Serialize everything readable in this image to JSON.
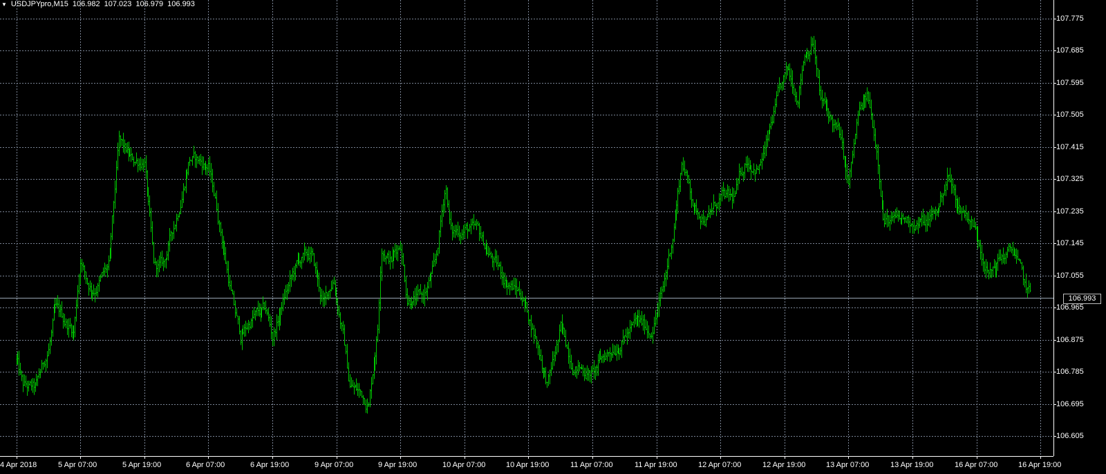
{
  "header": {
    "menu_icon": "triangle-down-icon",
    "symbol": "USDJPYpro,M15",
    "open": "106.982",
    "high": "107.023",
    "low": "106.979",
    "close": "106.993"
  },
  "colors": {
    "background": "#000000",
    "grid": "#7b8596",
    "bars": "#00c800",
    "axis": "#ffffff",
    "bid_line": "#9aa7b4"
  },
  "current_price": "106.993",
  "chart_data": {
    "type": "ohlc-bar",
    "title": "USDJPYpro,M15",
    "y_ticks": [
      "107.775",
      "107.685",
      "107.595",
      "107.505",
      "107.415",
      "107.325",
      "107.235",
      "107.145",
      "107.055",
      "106.965",
      "106.875",
      "106.785",
      "106.695",
      "106.605"
    ],
    "ylim": [
      106.59,
      107.79
    ],
    "x_ticks": [
      "4 Apr 2018",
      "5 Apr 07:00",
      "5 Apr 19:00",
      "6 Apr 07:00",
      "6 Apr 19:00",
      "9 Apr 07:00",
      "9 Apr 19:00",
      "10 Apr 07:00",
      "10 Apr 19:00",
      "11 Apr 07:00",
      "11 Apr 19:00",
      "12 Apr 07:00",
      "12 Apr 19:00",
      "13 Apr 07:00",
      "13 Apr 19:00",
      "16 Apr 07:00",
      "16 Apr 19:00"
    ],
    "grid": true,
    "series": [
      {
        "price_path": [
          {
            "t": 0,
            "p": 106.82
          },
          {
            "t": 0.1,
            "p": 106.74
          },
          {
            "t": 0.3,
            "p": 106.73
          },
          {
            "t": 0.5,
            "p": 106.85
          },
          {
            "t": 0.6,
            "p": 106.95
          },
          {
            "t": 0.9,
            "p": 106.9
          },
          {
            "t": 1.0,
            "p": 107.11
          },
          {
            "t": 1.1,
            "p": 107.04
          },
          {
            "t": 1.2,
            "p": 107.02
          },
          {
            "t": 1.45,
            "p": 107.08
          },
          {
            "t": 1.6,
            "p": 107.42
          },
          {
            "t": 1.8,
            "p": 107.37
          },
          {
            "t": 2.0,
            "p": 107.38
          },
          {
            "t": 2.15,
            "p": 107.07
          },
          {
            "t": 2.3,
            "p": 107.08
          },
          {
            "t": 2.5,
            "p": 107.22
          },
          {
            "t": 2.7,
            "p": 107.39
          },
          {
            "t": 3.0,
            "p": 107.36
          },
          {
            "t": 3.1,
            "p": 107.27
          },
          {
            "t": 3.25,
            "p": 107.12
          },
          {
            "t": 3.4,
            "p": 106.96
          },
          {
            "t": 3.5,
            "p": 106.88
          },
          {
            "t": 3.7,
            "p": 106.94
          },
          {
            "t": 3.9,
            "p": 106.95
          },
          {
            "t": 4.0,
            "p": 106.88
          },
          {
            "t": 4.2,
            "p": 107.0
          },
          {
            "t": 4.4,
            "p": 107.09
          },
          {
            "t": 4.6,
            "p": 107.11
          },
          {
            "t": 4.8,
            "p": 106.97
          },
          {
            "t": 4.95,
            "p": 107.05
          },
          {
            "t": 5.1,
            "p": 106.9
          },
          {
            "t": 5.2,
            "p": 106.75
          },
          {
            "t": 5.4,
            "p": 106.72
          },
          {
            "t": 5.5,
            "p": 106.7
          },
          {
            "t": 5.65,
            "p": 106.92
          },
          {
            "t": 5.7,
            "p": 107.15
          },
          {
            "t": 5.85,
            "p": 107.1
          },
          {
            "t": 6.0,
            "p": 107.15
          },
          {
            "t": 6.1,
            "p": 107.0
          },
          {
            "t": 6.35,
            "p": 106.99
          },
          {
            "t": 6.55,
            "p": 107.08
          },
          {
            "t": 6.7,
            "p": 107.31
          },
          {
            "t": 6.8,
            "p": 107.17
          },
          {
            "t": 7.0,
            "p": 107.19
          },
          {
            "t": 7.2,
            "p": 107.17
          },
          {
            "t": 7.4,
            "p": 107.11
          },
          {
            "t": 7.6,
            "p": 107.05
          },
          {
            "t": 7.9,
            "p": 107.0
          },
          {
            "t": 8.1,
            "p": 106.89
          },
          {
            "t": 8.3,
            "p": 106.75
          },
          {
            "t": 8.5,
            "p": 106.9
          },
          {
            "t": 8.7,
            "p": 106.81
          },
          {
            "t": 9.0,
            "p": 106.78
          },
          {
            "t": 9.2,
            "p": 106.83
          },
          {
            "t": 9.5,
            "p": 106.89
          },
          {
            "t": 9.7,
            "p": 106.92
          },
          {
            "t": 9.9,
            "p": 106.9
          },
          {
            "t": 10.1,
            "p": 107.01
          },
          {
            "t": 10.25,
            "p": 107.17
          },
          {
            "t": 10.4,
            "p": 107.38
          },
          {
            "t": 10.6,
            "p": 107.24
          },
          {
            "t": 10.8,
            "p": 107.22
          },
          {
            "t": 11.0,
            "p": 107.27
          },
          {
            "t": 11.2,
            "p": 107.26
          },
          {
            "t": 11.4,
            "p": 107.38
          },
          {
            "t": 11.6,
            "p": 107.36
          },
          {
            "t": 11.75,
            "p": 107.44
          },
          {
            "t": 11.9,
            "p": 107.55
          },
          {
            "t": 12.05,
            "p": 107.62
          },
          {
            "t": 12.2,
            "p": 107.56
          },
          {
            "t": 12.3,
            "p": 107.68
          },
          {
            "t": 12.45,
            "p": 107.72
          },
          {
            "t": 12.55,
            "p": 107.55
          },
          {
            "t": 12.7,
            "p": 107.5
          },
          {
            "t": 12.85,
            "p": 107.45
          },
          {
            "t": 13.0,
            "p": 107.3
          },
          {
            "t": 13.15,
            "p": 107.5
          },
          {
            "t": 13.3,
            "p": 107.55
          },
          {
            "t": 13.45,
            "p": 107.4
          },
          {
            "t": 13.55,
            "p": 107.22
          },
          {
            "t": 13.75,
            "p": 107.2
          },
          {
            "t": 14.0,
            "p": 107.21
          },
          {
            "t": 14.2,
            "p": 107.2
          },
          {
            "t": 14.4,
            "p": 107.24
          },
          {
            "t": 14.55,
            "p": 107.34
          },
          {
            "t": 14.7,
            "p": 107.25
          },
          {
            "t": 14.9,
            "p": 107.22
          },
          {
            "t": 15.05,
            "p": 107.15
          },
          {
            "t": 15.2,
            "p": 107.06
          },
          {
            "t": 15.4,
            "p": 107.11
          },
          {
            "t": 15.6,
            "p": 107.12
          },
          {
            "t": 15.75,
            "p": 107.02
          },
          {
            "t": 15.85,
            "p": 106.99
          }
        ]
      }
    ]
  }
}
